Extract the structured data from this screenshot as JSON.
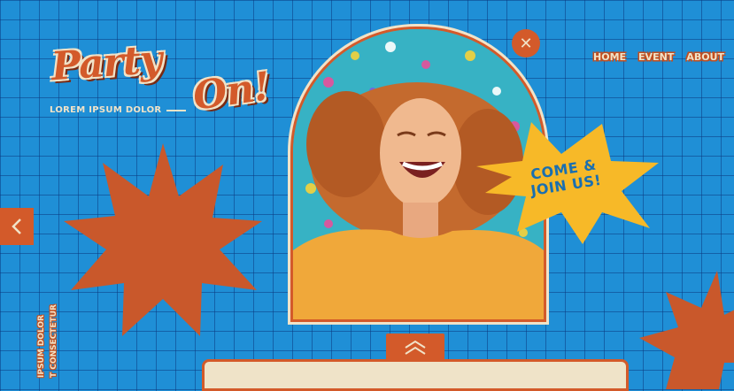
{
  "logo": {
    "word1": "Party",
    "word2": "On!"
  },
  "tagline": "LOREM IPSUM DOLOR",
  "nav": {
    "home": "HOME",
    "event": "EVENT",
    "about": "ABOUT"
  },
  "close_symbol": "✕",
  "burst": {
    "line1": "COME &",
    "line2": "JOIN US!"
  },
  "side_text": {
    "line1": "IPSUM DOLOR",
    "line2": "T CONSECTETUR"
  },
  "colors": {
    "background": "#1f8fd6",
    "accent": "#d35a2a",
    "cream": "#f1e3c8",
    "yellow": "#f7b928"
  },
  "icons": {
    "close": "close-icon",
    "prev": "chevron-left-icon",
    "up": "chevron-up-icon"
  }
}
